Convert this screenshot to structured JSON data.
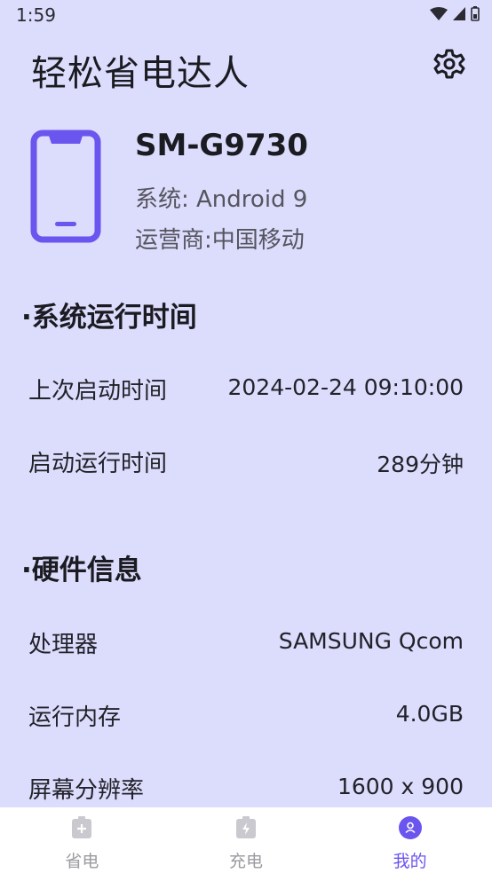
{
  "status_bar": {
    "time": "1:59"
  },
  "header": {
    "title": "轻松省电达人",
    "settings_icon": "gear-icon"
  },
  "device": {
    "model": "SM-G9730",
    "os": "系统: Android 9",
    "carrier": "运营商:中国移动",
    "icon": "smartphone-icon"
  },
  "sections": [
    {
      "title": "·系统运行时间",
      "rows": [
        {
          "label": "上次启动时间",
          "value": "2024-02-24 09:10:00"
        },
        {
          "label": "启动运行时间",
          "value": "289分钟"
        }
      ]
    },
    {
      "title": "·硬件信息",
      "rows": [
        {
          "label": "处理器",
          "value": "SAMSUNG Qcom"
        },
        {
          "label": "运行内存",
          "value": "4.0GB"
        },
        {
          "label": "屏幕分辨率",
          "value": "1600 x 900"
        }
      ]
    }
  ],
  "bottom_nav": {
    "items": [
      {
        "label": "省电",
        "icon": "battery-plus-icon",
        "active": false
      },
      {
        "label": "充电",
        "icon": "battery-charging-icon",
        "active": false
      },
      {
        "label": "我的",
        "icon": "profile-icon",
        "active": true
      }
    ]
  },
  "colors": {
    "background": "#dcdcfc",
    "accent": "#6a55ee",
    "inactive": "#9a9aa0"
  }
}
